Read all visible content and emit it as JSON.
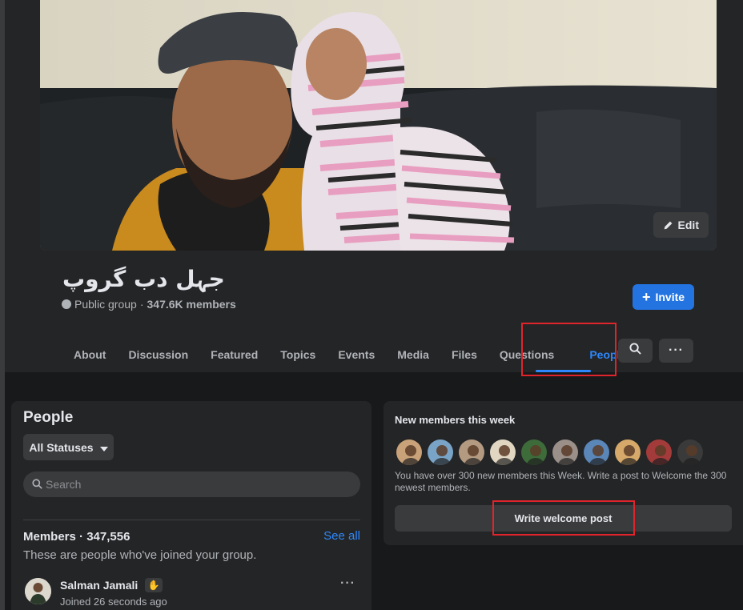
{
  "group": {
    "name": "جہل دب گروپ",
    "privacy": "Public group",
    "separator": "·",
    "member_count": "347.6K members",
    "invite_label": "Invite",
    "edit_label": "Edit"
  },
  "tabs": [
    {
      "label": "About"
    },
    {
      "label": "Discussion"
    },
    {
      "label": "Featured"
    },
    {
      "label": "Topics"
    },
    {
      "label": "Events"
    },
    {
      "label": "Media"
    },
    {
      "label": "Files"
    },
    {
      "label": "Questions"
    },
    {
      "label": "People",
      "active": true
    }
  ],
  "people": {
    "title": "People",
    "status_filter": "All Statuses",
    "search_placeholder": "Search",
    "members_label": "Members · 347,556",
    "see_all": "See all",
    "members_desc": "These are people who've joined your group.",
    "first_member": {
      "name": "Salman Jamali",
      "joined": "Joined 26 seconds ago"
    }
  },
  "new_members": {
    "title": "New members this week",
    "description": "You have over 300 new members this Week. Write a post to Welcome the 300 newest members.",
    "welcome_button": "Write welcome post",
    "avatar_colors": [
      "#c9a27a",
      "#7aa4c7",
      "#b59a82",
      "#e0d6c2",
      "#3d6b3a",
      "#9b8f8a",
      "#5a86b8",
      "#d6a96a",
      "#a33b3b",
      "#3a3a3a"
    ]
  },
  "colors": {
    "accent": "#2d88ff",
    "button_blue": "#2374e1",
    "highlight": "#e0242c"
  }
}
